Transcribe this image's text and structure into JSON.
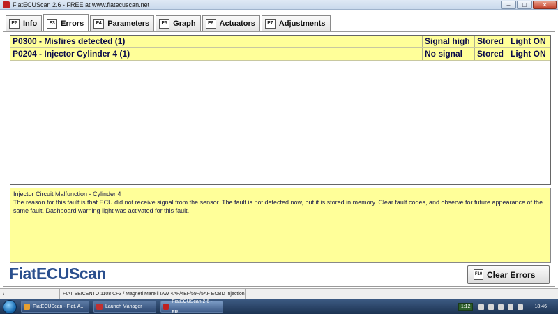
{
  "window": {
    "title": "FiatECUScan 2.6 - FREE at www.fiatecuscan.net",
    "controls": {
      "minimize": "–",
      "maximize": "□",
      "close": "✕"
    }
  },
  "tabs": [
    {
      "key": "F2",
      "label": "Info"
    },
    {
      "key": "F3",
      "label": "Errors",
      "active": true
    },
    {
      "key": "F4",
      "label": "Parameters"
    },
    {
      "key": "F5",
      "label": "Graph"
    },
    {
      "key": "F6",
      "label": "Actuators"
    },
    {
      "key": "F7",
      "label": "Adjustments"
    }
  ],
  "errors": [
    {
      "description": "P0300 - Misfires detected (1)",
      "signal": "Signal high",
      "stored": "Stored",
      "light": "Light ON"
    },
    {
      "description": "P0204 - Injector Cylinder 4 (1)",
      "signal": "No signal",
      "stored": "Stored",
      "light": "Light ON"
    }
  ],
  "detail": {
    "title": "Injector Circuit Malfunction - Cylinder 4",
    "text": "The reason for this fault is that ECU did not receive signal from the sensor. The fault is not detected now, but it is stored in memory. Clear fault codes, and observe for future appearance of the same fault. Dashboard warning light was activated for this fault."
  },
  "logo": "FiatECUScan",
  "clear_button": {
    "key": "F10",
    "label": "Clear Errors"
  },
  "statusbar": {
    "first": "\\",
    "vehicle": "FIAT SEICENTO 1108 CF3 / Magneti Marelli IAW 4AF/4EF/59F/5AF EOBD Injection"
  },
  "taskbar": {
    "items": [
      {
        "label": "FiatECUScan - Fiat, A...",
        "icon_color": "#e8a030"
      },
      {
        "label": "Launch Manager",
        "icon_color": "#c03030"
      },
      {
        "label": "FiatECUScan 2.6 - FR...",
        "icon_color": "#c02020"
      }
    ],
    "language": "1:12",
    "clock": "18:46"
  },
  "colors": {
    "error_row_bg": "#ffff99",
    "error_text": "#0a0a4a",
    "logo": "#2a4f8e"
  }
}
